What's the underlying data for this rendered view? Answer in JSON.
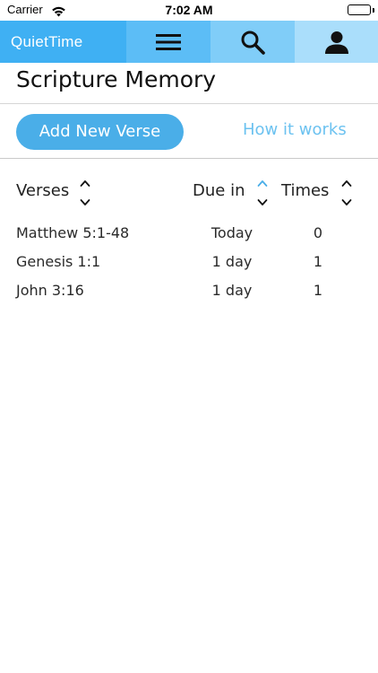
{
  "status_bar": {
    "carrier": "Carrier",
    "time": "7:02 AM"
  },
  "nav": {
    "brand": "QuietTime",
    "icons": [
      "menu-icon",
      "search-icon",
      "user-icon"
    ]
  },
  "page": {
    "title": "Scripture Memory"
  },
  "actions": {
    "add_label": "Add New Verse",
    "how_label": "How it works"
  },
  "table": {
    "headers": {
      "verses": "Verses",
      "due": "Due in",
      "times": "Times"
    },
    "active_sort": "due",
    "rows": [
      {
        "verse": "Matthew 5:1-48",
        "due": "Today",
        "times": "0"
      },
      {
        "verse": "Genesis 1:1",
        "due": "1 day",
        "times": "1"
      },
      {
        "verse": "John 3:16",
        "due": "1 day",
        "times": "1"
      }
    ]
  },
  "colors": {
    "brand": "#3fb0f3",
    "button": "#4aaee8",
    "link": "#6cc2f0",
    "sort_active": "#4aaee8"
  }
}
